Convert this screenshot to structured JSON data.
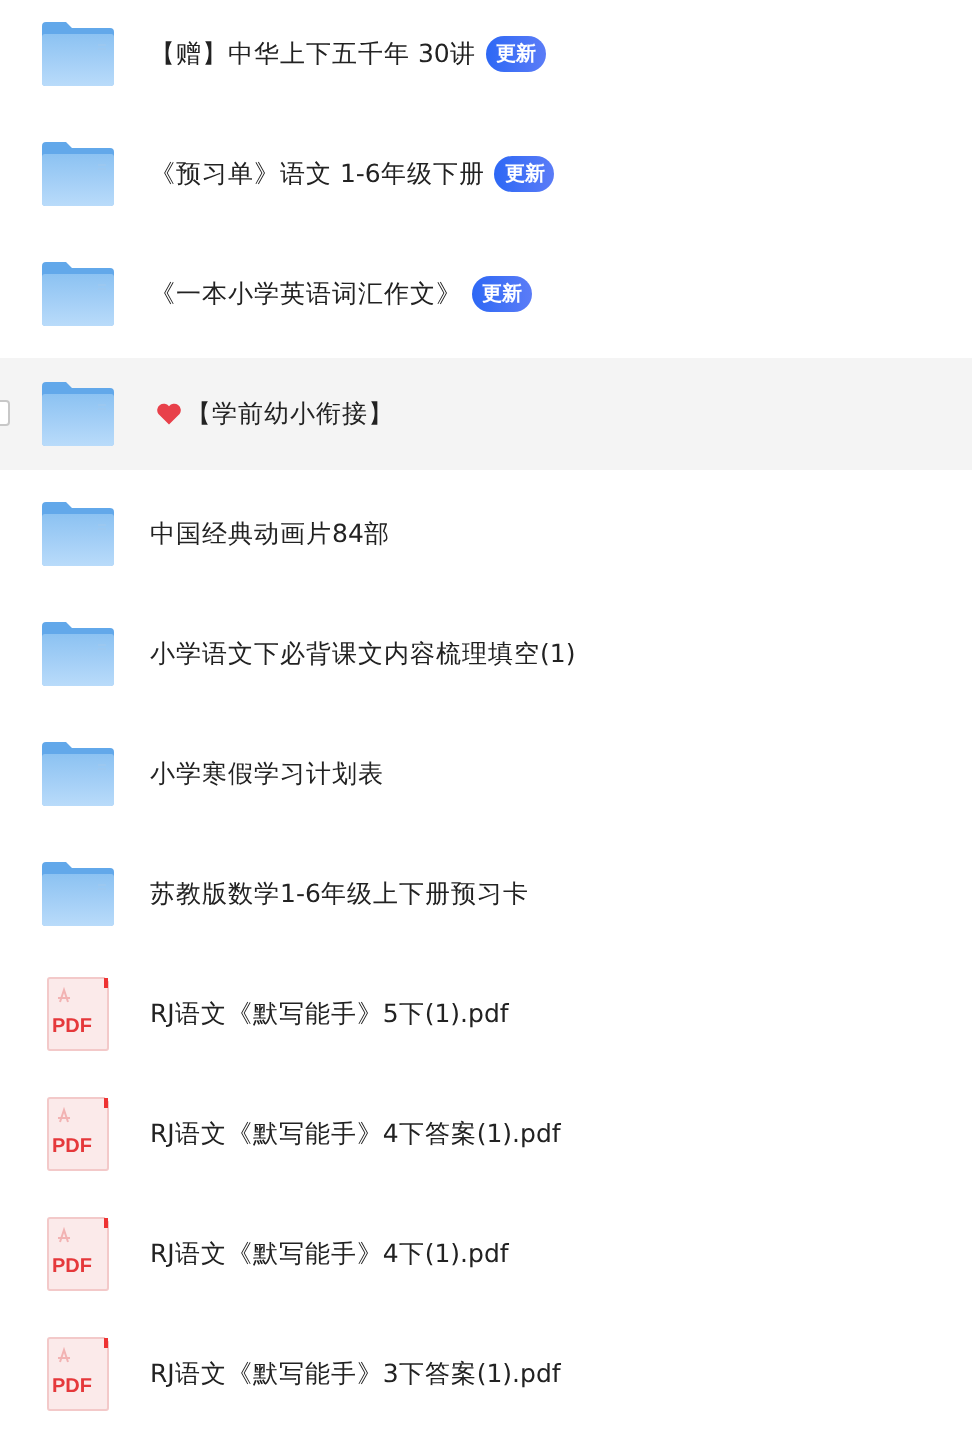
{
  "files": [
    {
      "kind": "folder",
      "name": "【赠】中华上下五千年 30讲",
      "badge": "更新",
      "highlighted": false
    },
    {
      "kind": "folder",
      "name": "《预习单》语文 1-6年级下册",
      "badge": "更新",
      "highlighted": false
    },
    {
      "kind": "folder",
      "name": "《一本小学英语词汇作文》",
      "badge": "更新",
      "highlighted": false
    },
    {
      "kind": "folder",
      "name": "【学前幼小衔接】",
      "heart": true,
      "highlighted": true
    },
    {
      "kind": "folder",
      "name": "中国经典动画片84部",
      "highlighted": false
    },
    {
      "kind": "folder",
      "name": "小学语文下必背课文内容梳理填空(1)",
      "highlighted": false
    },
    {
      "kind": "folder",
      "name": "小学寒假学习计划表",
      "highlighted": false
    },
    {
      "kind": "folder",
      "name": "苏教版数学1-6年级上下册预习卡",
      "highlighted": false
    },
    {
      "kind": "pdf",
      "name": "RJ语文《默写能手》5下(1).pdf",
      "icon_text": "PDF",
      "highlighted": false
    },
    {
      "kind": "pdf",
      "name": "RJ语文《默写能手》4下答案(1).pdf",
      "icon_text": "PDF",
      "highlighted": false
    },
    {
      "kind": "pdf",
      "name": "RJ语文《默写能手》4下(1).pdf",
      "icon_text": "PDF",
      "highlighted": false
    },
    {
      "kind": "pdf",
      "name": "RJ语文《默写能手》3下答案(1).pdf",
      "icon_text": "PDF",
      "highlighted": false
    }
  ]
}
